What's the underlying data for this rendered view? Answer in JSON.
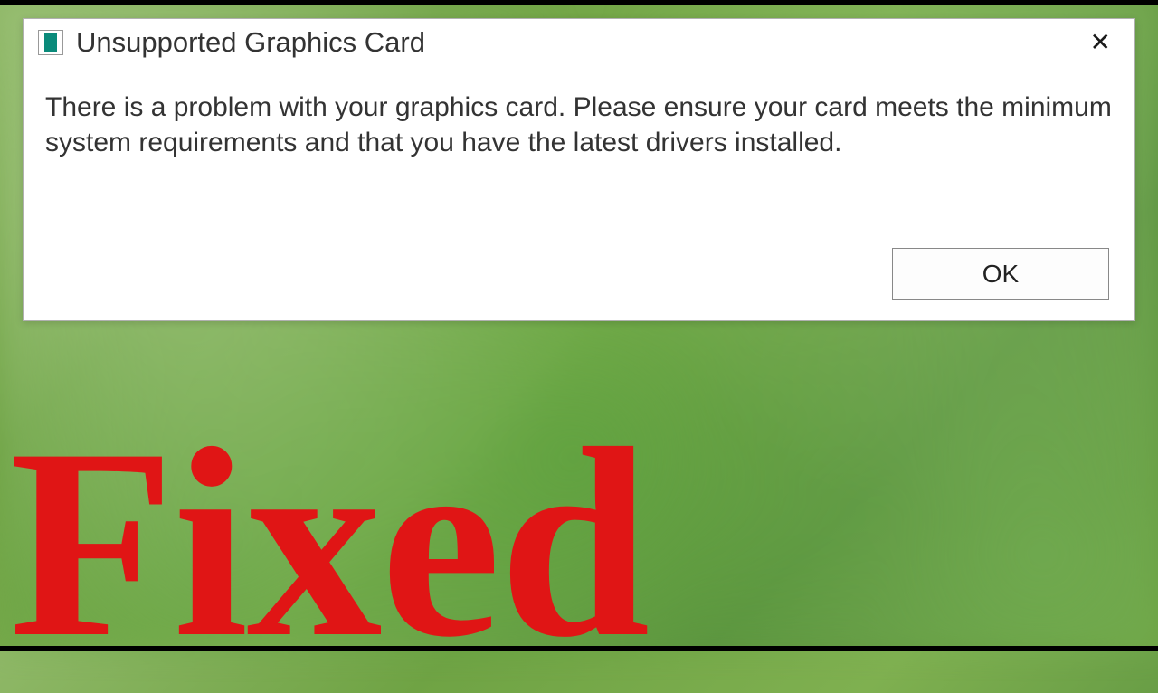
{
  "dialog": {
    "title": "Unsupported Graphics Card",
    "message": "There is a problem with your graphics card. Please ensure your card meets the minimum system requirements and that you have the latest drivers installed.",
    "ok_label": "OK",
    "close_symbol": "✕"
  },
  "overlay": {
    "text": "Fixed"
  }
}
